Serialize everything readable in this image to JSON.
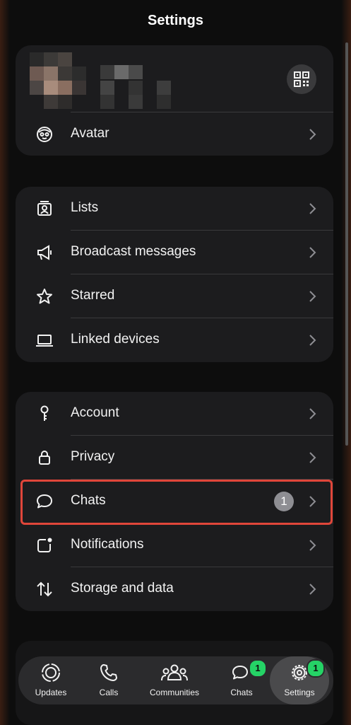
{
  "header": {
    "title": "Settings"
  },
  "profile": {
    "qr_icon": "qr-code-icon"
  },
  "section_profile": [
    {
      "label": "Avatar",
      "icon": "avatar-face-icon"
    }
  ],
  "section_tools": [
    {
      "label": "Lists",
      "icon": "lists-icon"
    },
    {
      "label": "Broadcast messages",
      "icon": "megaphone-icon"
    },
    {
      "label": "Starred",
      "icon": "star-icon"
    },
    {
      "label": "Linked devices",
      "icon": "laptop-icon"
    }
  ],
  "section_settings": [
    {
      "label": "Account",
      "icon": "key-icon"
    },
    {
      "label": "Privacy",
      "icon": "lock-icon"
    },
    {
      "label": "Chats",
      "icon": "chat-bubble-icon",
      "badge": "1"
    },
    {
      "label": "Notifications",
      "icon": "notification-icon"
    },
    {
      "label": "Storage and data",
      "icon": "arrows-updown-icon"
    }
  ],
  "tabbar": {
    "items": [
      {
        "label": "Updates",
        "icon": "updates-icon"
      },
      {
        "label": "Calls",
        "icon": "phone-icon"
      },
      {
        "label": "Communities",
        "icon": "communities-icon"
      },
      {
        "label": "Chats",
        "icon": "chats-icon",
        "badge": "1"
      },
      {
        "label": "Settings",
        "icon": "settings-gear-icon",
        "badge": "1",
        "active": true
      }
    ]
  },
  "colors": {
    "accent_badge": "#25d366",
    "highlight": "#e0463a",
    "card": "#1c1c1e"
  }
}
